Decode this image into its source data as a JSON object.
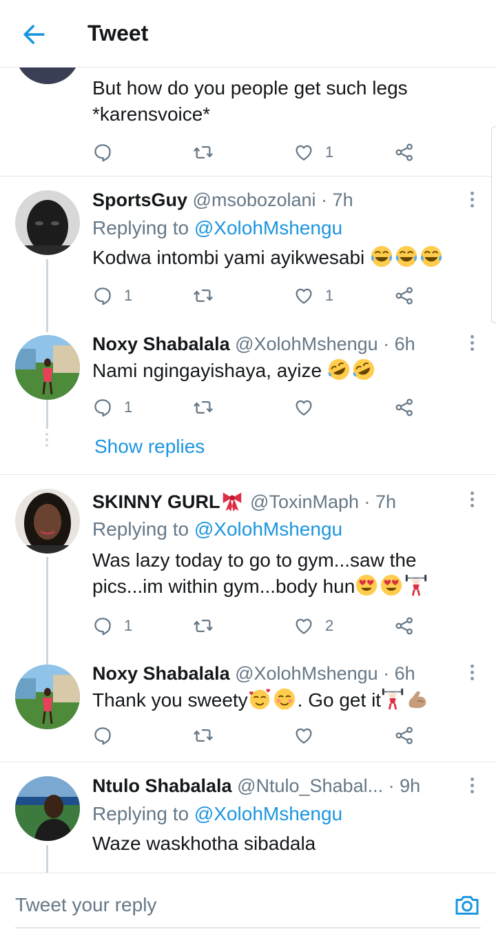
{
  "header": {
    "title": "Tweet"
  },
  "top_tweet": {
    "text": "But how do you people get such legs *karensvoice*",
    "likes": "1"
  },
  "tweets": [
    {
      "name": "SportsGuy",
      "handle": "@msobozolani",
      "time": "· 7h",
      "replying_label": "Replying to",
      "replying_to": "@XolohMshengu",
      "text": "Kodwa intombi yami ayikwesabi",
      "emojis": [
        "joy",
        "joy",
        "joy"
      ],
      "replies": "1",
      "likes": "1"
    },
    {
      "name": "Noxy Shabalala",
      "handle": "@XolohMshengu",
      "time": "· 6h",
      "text": "Nami ngingayishaya, ayize",
      "emojis": [
        "rofl",
        "rofl"
      ],
      "replies": "1",
      "likes": "",
      "show_replies": "Show replies"
    },
    {
      "name": "SKINNY GURL",
      "name_emoji": "ribbon",
      "handle": "@ToxinMaph",
      "time": "· 7h",
      "replying_label": "Replying to",
      "replying_to": "@XolohMshengu",
      "text_line1": "Was lazy today to go to gym...saw the",
      "text_line2": "pics...im within gym...body hun",
      "emojis": [
        "heart-eyes",
        "heart-eyes",
        "weightlifter"
      ],
      "replies": "1",
      "likes": "2"
    },
    {
      "name": "Noxy Shabalala",
      "handle": "@XolohMshengu",
      "time": "· 6h",
      "text_part1": "Thank you sweety",
      "text_part2": ". Go get it",
      "emojis_a": [
        "smiling-hearts",
        "blush"
      ],
      "emojis_b": [
        "weightlifter",
        "flexed-biceps"
      ],
      "replies": "",
      "likes": ""
    },
    {
      "name": "Ntulo Shabalala",
      "handle": "@Ntulo_Shabal...",
      "time": "· 9h",
      "replying_label": "Replying to",
      "replying_to": "@XolohMshengu",
      "text": "Waze waskhotha sibadala"
    }
  ],
  "composer": {
    "placeholder": "Tweet your reply"
  },
  "icons": {
    "back": "arrow-left-icon",
    "reply": "reply-icon",
    "retweet": "retweet-icon",
    "like": "heart-icon",
    "share": "share-icon",
    "more": "more-vertical-icon",
    "camera": "camera-icon"
  },
  "colors": {
    "accent": "#1b95e0",
    "secondary_text": "#657786",
    "divider": "#e1e8ed"
  }
}
